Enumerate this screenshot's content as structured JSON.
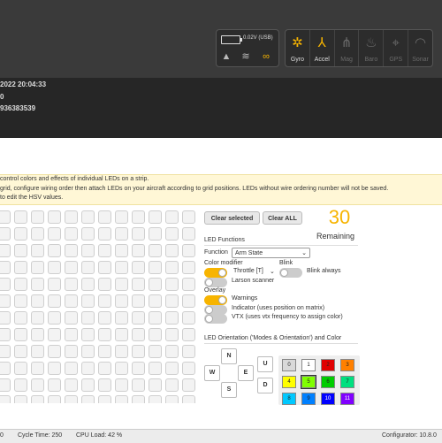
{
  "header": {
    "voltage": "0.02V (USB)",
    "sensors": [
      {
        "name": "Gyro",
        "icon": "gyro-icon",
        "state": "on"
      },
      {
        "name": "Accel",
        "icon": "accel-icon",
        "state": "on"
      },
      {
        "name": "Mag",
        "icon": "mag-icon",
        "state": "off"
      },
      {
        "name": "Baro",
        "icon": "baro-icon",
        "state": "off"
      },
      {
        "name": "GPS",
        "icon": "gps-icon",
        "state": "off"
      },
      {
        "name": "Sonar",
        "icon": "sonar-icon",
        "state": "off"
      }
    ],
    "colors": {
      "accent": "#f7b400",
      "background": "#3a3a3a"
    }
  },
  "info": {
    "line1": "2022 20:04:33",
    "line2": "0",
    "line3": "936383539"
  },
  "note": {
    "line1": "control colors and effects of individual LEDs on a strip.",
    "line2": "grid, configure wiring order then attach LEDs on your aircraft according to grid positions. LEDs without wire ordering number will not be saved.",
    "line3": "to edit the HSV values."
  },
  "panel": {
    "clear_selected": "Clear selected",
    "clear_all": "Clear ALL",
    "remaining_count": "30",
    "remaining_label": "Remaining",
    "led_functions_title": "LED Functions",
    "function_label": "Function",
    "function_value": "Arm State",
    "color_modifier_label": "Color modifier",
    "throttle_label": "Throttle [T]",
    "larson_label": "Larson scanner",
    "blink_title": "Blink",
    "blink_always_label": "Blink always",
    "overlay_label": "Overlay",
    "warnings_label": "Warnings",
    "indicator_label": "Indicator (uses position on matrix)",
    "vtx_label": "VTX (uses vtx frequency to assign color)",
    "orientation_title": "LED Orientation ('Modes & Orientation') and Color",
    "directions": {
      "n": "N",
      "w": "W",
      "e": "E",
      "s": "S",
      "u": "U",
      "d": "D"
    },
    "colors": [
      {
        "label": "0",
        "hex": "#d9d9d9"
      },
      {
        "label": "1",
        "hex": "#ffffff"
      },
      {
        "label": "2",
        "hex": "#e00000"
      },
      {
        "label": "3",
        "hex": "#ff8000"
      },
      {
        "label": "4",
        "hex": "#ffff00"
      },
      {
        "label": "5",
        "hex": "#80ff00"
      },
      {
        "label": "6",
        "hex": "#00cc00"
      },
      {
        "label": "7",
        "hex": "#00e080"
      },
      {
        "label": "8",
        "hex": "#00c8ff"
      },
      {
        "label": "9",
        "hex": "#0080ff"
      },
      {
        "label": "10",
        "hex": "#0000ff"
      },
      {
        "label": "11",
        "hex": "#8000ff"
      }
    ]
  },
  "footer": {
    "left": "0",
    "cycle_time": "Cycle Time: 250",
    "cpu_load": "CPU Load: 42 %",
    "configurator": "Configurator: 10.8.0"
  }
}
